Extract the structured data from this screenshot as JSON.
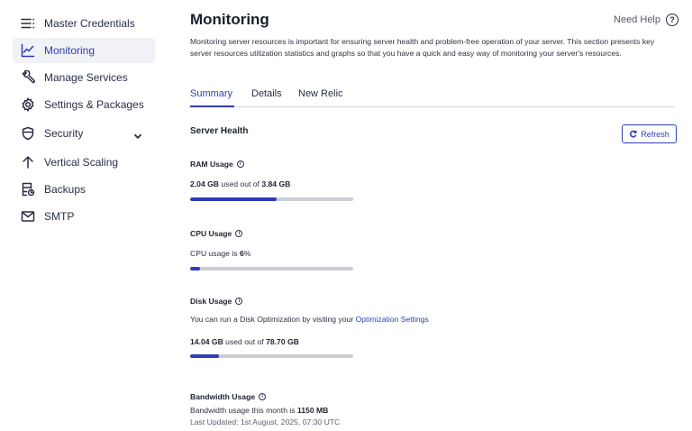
{
  "sidebar": {
    "items": [
      {
        "label": "Master Credentials",
        "icon": "list-lines-icon",
        "active": false
      },
      {
        "label": "Monitoring",
        "icon": "line-chart-icon",
        "active": true
      },
      {
        "label": "Manage Services",
        "icon": "wrench-icon",
        "active": false
      },
      {
        "label": "Settings & Packages",
        "icon": "gear-icon",
        "active": false
      },
      {
        "label": "Security",
        "icon": "shield-icon",
        "active": false,
        "expandable": true
      },
      {
        "label": "Vertical Scaling",
        "icon": "arrow-up-icon",
        "active": false
      },
      {
        "label": "Backups",
        "icon": "backup-icon",
        "active": false
      },
      {
        "label": "SMTP",
        "icon": "mail-icon",
        "active": false
      }
    ]
  },
  "header": {
    "title": "Monitoring",
    "help_label": "Need Help",
    "description": "Monitoring server resources is important for ensuring server health and problem-free operation of your server. This section presents key server resources utilization statistics and graphs so that you have a quick and easy way of monitoring your server's resources."
  },
  "tabs": [
    {
      "label": "Summary",
      "active": true
    },
    {
      "label": "Details",
      "active": false
    },
    {
      "label": "New Relic",
      "active": false
    }
  ],
  "server_health": {
    "title": "Server Health",
    "refresh_label": "Refresh",
    "ram": {
      "label": "RAM Usage",
      "used": "2.04 GB",
      "mid": " used out of ",
      "total": "3.84 GB",
      "fill_fraction": 0.531
    },
    "cpu": {
      "label": "CPU Usage",
      "prefix": "CPU usage is ",
      "value": "6",
      "suffix": "%",
      "fill_fraction": 0.06
    },
    "disk": {
      "label": "Disk Usage",
      "hint_prefix": "You can run a Disk Optimization by visiting your ",
      "hint_link": "Optimization Settings",
      "used": "14.04 GB",
      "mid": " used out of ",
      "total": "78.70 GB",
      "fill_fraction": 0.178
    },
    "bandwidth": {
      "label": "Bandwidth Usage",
      "prefix": "Bandwidth usage this month is ",
      "value": "1150 MB",
      "last_updated": "Last Updated: 1st August, 2025, 07:30 UTC"
    }
  },
  "colors": {
    "accent": "#2f3db6",
    "bar_track": "#cbcdd6",
    "active_bg": "#f1f2f6"
  }
}
